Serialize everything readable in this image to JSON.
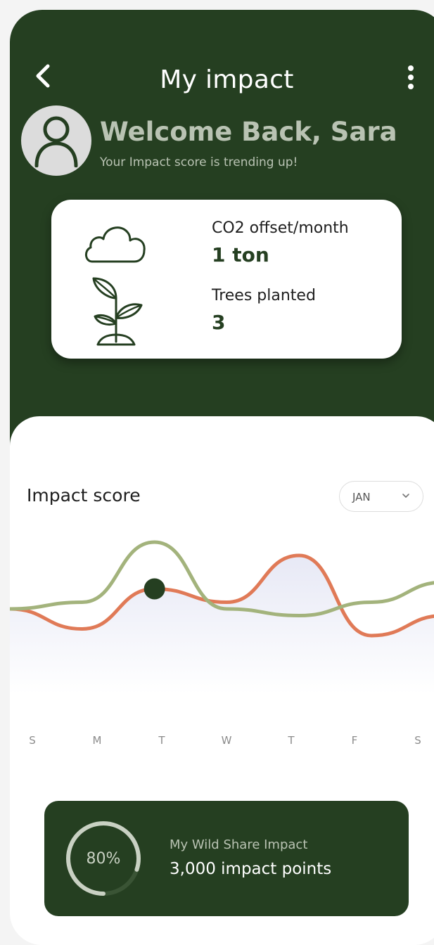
{
  "header": {
    "title": "My impact",
    "back_icon": "chevron-left-icon",
    "menu_icon": "more-vertical-icon"
  },
  "user": {
    "avatar_icon": "user-icon",
    "welcome": "Welcome Back, Sara",
    "subtitle": "Your Impact score is trending up!"
  },
  "stats": {
    "co2_icon": "cloud-icon",
    "co2_label": "CO2 offset/month",
    "co2_value": "1 ton",
    "trees_icon": "sprout-icon",
    "trees_label": "Trees planted",
    "trees_value": "3"
  },
  "impact_score": {
    "title": "Impact score",
    "month": "JAN",
    "days": [
      "S",
      "M",
      "T",
      "W",
      "T",
      "F",
      "S"
    ]
  },
  "chart_data": {
    "type": "line",
    "categories": [
      "S",
      "M",
      "T",
      "W",
      "T",
      "F",
      "S"
    ],
    "series": [
      {
        "values": [
          4.0,
          4.5,
          9.0,
          4.0,
          3.5,
          4.5,
          6.0
        ],
        "color": "#a3b37c"
      },
      {
        "values": [
          4.0,
          2.5,
          5.5,
          4.5,
          8.0,
          2.0,
          3.5
        ],
        "color": "#e07a57"
      }
    ],
    "highlight": {
      "category": "T",
      "value": 5.5
    },
    "ylim": [
      0,
      10
    ],
    "grid": false,
    "legend": "none",
    "colors": {
      "area": "#dfe1f2",
      "highlight": "#253f21"
    }
  },
  "impact_summary": {
    "percent": 80,
    "percent_label": "80%",
    "label": "My Wild Share Impact",
    "points": "3,000 impact points"
  },
  "colors": {
    "primary": "#253f21",
    "muted_text": "#b9c3b3",
    "background": "#ffffff",
    "avatar_bg": "#dcdcdc"
  }
}
